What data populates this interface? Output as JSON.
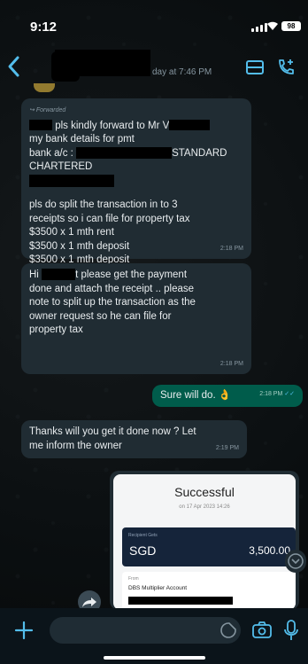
{
  "status_bar": {
    "time": "9:12",
    "battery": "98"
  },
  "header": {
    "last_seen": "day at 7:46 PM",
    "icons": [
      "back-icon",
      "list-icon",
      "video-call-icon"
    ]
  },
  "messages": [
    {
      "direction": "incoming",
      "forwarded_label": "Forwarded",
      "lines": [
        "pls kindly forward to Mr V",
        "my bank details for pmt",
        "bank a/c :",
        "STANDARD",
        "CHARTERED",
        "pls do split the transaction in to 3",
        "receipts so i can file for property tax",
        "$3500 x 1 mth rent",
        "$3500 x 1 mth deposit",
        "$3500 x 1 mth deposit"
      ],
      "time": "2:18 PM"
    },
    {
      "direction": "incoming",
      "lines": [
        "Hi",
        "t please get the payment",
        "done and attach the receipt .. please",
        "note to split up the transaction as the",
        "owner request so he can file for",
        "property tax"
      ],
      "time": "2:18 PM"
    },
    {
      "direction": "outgoing",
      "text": "Sure will do.",
      "emoji": "👌",
      "time": "2:18 PM"
    },
    {
      "direction": "incoming",
      "lines": [
        "Thanks will you get it done now ? Let",
        "me inform the owner"
      ],
      "time": "2:19 PM"
    }
  ],
  "receipt": {
    "title": "Successful",
    "date": "on 17 Apr 2023 14:26",
    "amount_label": "Recipient Gets",
    "currency": "SGD",
    "amount": "3,500.00",
    "from_label": "From",
    "from_account": "DBS Multiplier Account"
  },
  "input_bar": {
    "placeholder": ""
  },
  "colors": {
    "incoming_bubble": "#202c33",
    "outgoing_bubble": "#005c4b",
    "background": "#0b141a",
    "accent": "#53bdeb"
  }
}
